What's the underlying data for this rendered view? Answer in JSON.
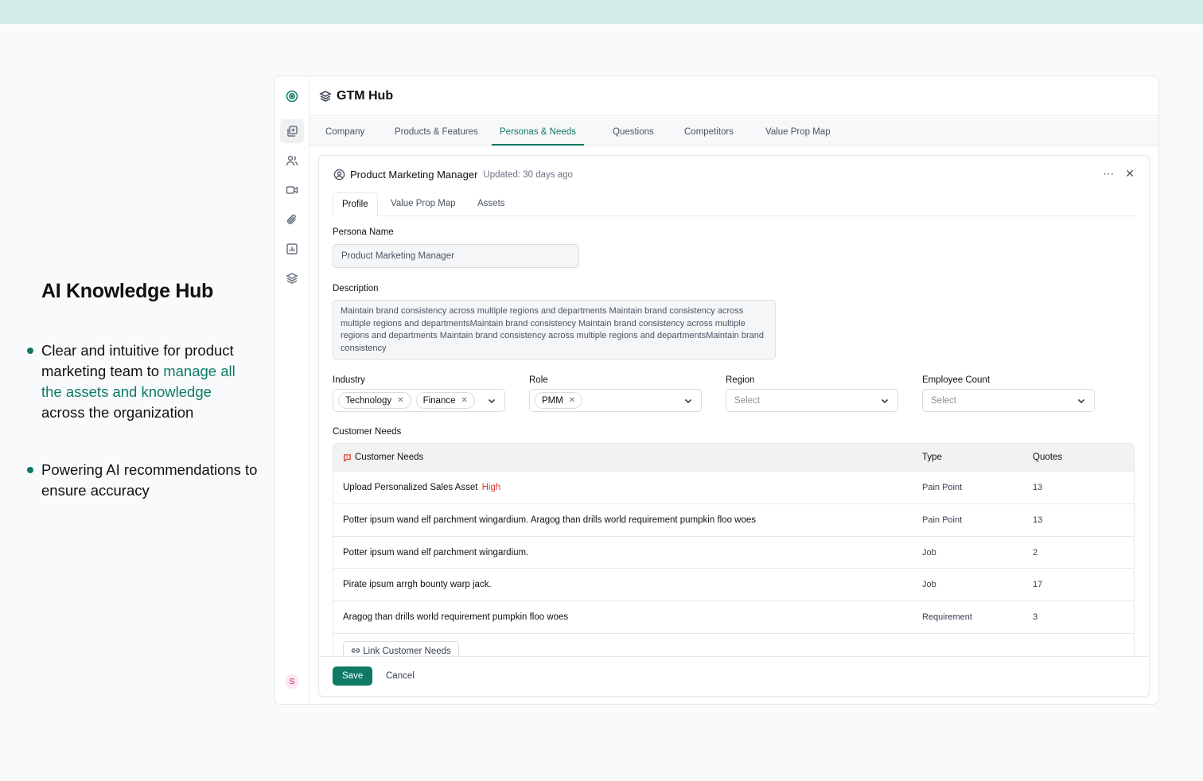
{
  "hero": {
    "title": "AI Knowledge Hub",
    "bullet1_pre": "Clear and intuitive for product marketing team to ",
    "bullet1_highlight": "manage all the assets and knowledge",
    "bullet1_post": " across the organization",
    "bullet2": "Powering AI recommendations to ensure accuracy"
  },
  "app": {
    "title": "GTM Hub",
    "rail_icons": [
      "target-icon",
      "library-icon",
      "users-icon",
      "video-icon",
      "paperclip-icon",
      "chart-icon",
      "layers-icon"
    ],
    "avatar_initial": "S",
    "tabs": [
      {
        "label": "Company"
      },
      {
        "label": "Products & Features"
      },
      {
        "label": "Personas & Needs",
        "active": true
      },
      {
        "label": "Questions"
      },
      {
        "label": "Competitors"
      },
      {
        "label": "Value Prop Map"
      }
    ],
    "accent_color": "#0f7a66"
  },
  "panel": {
    "persona_title": "Product Marketing Manager",
    "updated": "Updated: 30 days ago",
    "subtabs": [
      {
        "label": "Profile",
        "active": true
      },
      {
        "label": "Value Prop Map"
      },
      {
        "label": "Assets"
      }
    ],
    "persona_name_label": "Persona Name",
    "persona_name_value": "Product Marketing Manager",
    "description_label": "Description",
    "description_value": "Maintain brand consistency across multiple regions and departments Maintain brand consistency across multiple regions and departmentsMaintain brand consistency Maintain brand consistency across multiple regions and departments Maintain brand consistency across multiple regions and departmentsMaintain brand consistency",
    "industry": {
      "label": "Industry",
      "chips": [
        "Technology",
        "Finance"
      ]
    },
    "role": {
      "label": "Role",
      "chips": [
        "PMM"
      ]
    },
    "region": {
      "label": "Region",
      "placeholder": "Select"
    },
    "employee_count": {
      "label": "Employee Count",
      "placeholder": "Select"
    },
    "customer_needs_label": "Customer Needs",
    "table": {
      "headers": [
        "Customer Needs",
        "Type",
        "Quotes"
      ],
      "rows": [
        {
          "need": "Upload Personalized Sales Asset",
          "priority": "High",
          "type": "Pain Point",
          "quotes": "13"
        },
        {
          "need": "Potter ipsum wand elf parchment wingardium. Aragog than drills world requirement pumpkin floo woes",
          "priority": "",
          "type": "Pain Point",
          "quotes": "13"
        },
        {
          "need": "Potter ipsum wand elf parchment wingardium.",
          "priority": "",
          "type": "Job",
          "quotes": "2"
        },
        {
          "need": "Pirate ipsum arrgh bounty warp jack.",
          "priority": "",
          "type": "Job",
          "quotes": "17"
        },
        {
          "need": "Aragog than drills world requirement pumpkin floo woes",
          "priority": "",
          "type": "Requirement",
          "quotes": "3"
        }
      ],
      "link_button": "Link Customer Needs"
    },
    "save_label": "Save",
    "cancel_label": "Cancel"
  }
}
